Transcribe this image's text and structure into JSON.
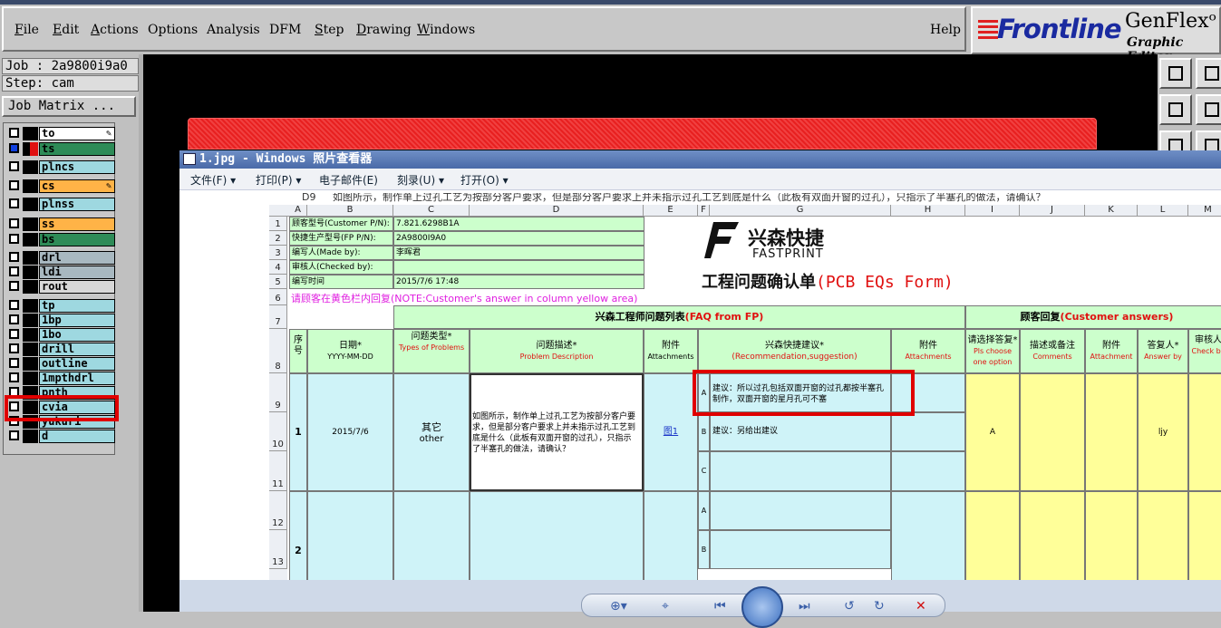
{
  "menubar": {
    "items": [
      "File",
      "Edit",
      "Actions",
      "Options",
      "Analysis",
      "DFM",
      "Step",
      "Drawing",
      "Windows"
    ],
    "help": "Help"
  },
  "logo": {
    "brand": "Frontline",
    "product": "GenFlex",
    "suffix": "ᵒ",
    "subtitle": "Graphic Editor"
  },
  "job": {
    "job_line": "Job : 2a9800i9a0",
    "step_line": "Step: cam",
    "matrix_button": "Job Matrix ..."
  },
  "layers": [
    {
      "name": "to",
      "color": "#ffffff",
      "pen": true,
      "marker": "black"
    },
    {
      "name": "ts",
      "color": "#2e8b57",
      "pen": false,
      "marker": "red"
    },
    {
      "name": "plncs",
      "color": "#9ed8e0",
      "pen": false,
      "marker": "black"
    },
    {
      "name": "cs",
      "color": "#ffb347",
      "pen": true,
      "marker": "black"
    },
    {
      "name": "plnss",
      "color": "#9ed8e0",
      "pen": false,
      "marker": "black"
    },
    {
      "name": "ss",
      "color": "#ffb347",
      "pen": false,
      "marker": "black"
    },
    {
      "name": "bs",
      "color": "#2e8b57",
      "pen": false,
      "marker": "black"
    },
    {
      "name": "drl",
      "color": "#a8b8c0",
      "pen": false,
      "marker": "black"
    },
    {
      "name": "ldi",
      "color": "#a8b8c0",
      "pen": false,
      "marker": "black"
    },
    {
      "name": "rout",
      "color": "#d8d8d8",
      "pen": false,
      "marker": "black"
    },
    {
      "name": "tp",
      "color": "#9ed8e0",
      "pen": false,
      "marker": "black"
    },
    {
      "name": "1bp",
      "color": "#9ed8e0",
      "pen": false,
      "marker": "black"
    },
    {
      "name": "1bo",
      "color": "#9ed8e0",
      "pen": false,
      "marker": "black"
    },
    {
      "name": "drill",
      "color": "#9ed8e0",
      "pen": false,
      "marker": "black"
    },
    {
      "name": "outline",
      "color": "#9ed8e0",
      "pen": false,
      "marker": "black"
    },
    {
      "name": "1mpthdrl",
      "color": "#9ed8e0",
      "pen": false,
      "marker": "black"
    },
    {
      "name": "pnth",
      "color": "#9ed8e0",
      "pen": false,
      "marker": "black"
    },
    {
      "name": "cvia",
      "color": "#9ed8e0",
      "pen": false,
      "marker": "black"
    },
    {
      "name": "yukuri",
      "color": "#9ed8e0",
      "pen": false,
      "marker": "black"
    },
    {
      "name": "d",
      "color": "#9ed8e0",
      "pen": false,
      "marker": "black"
    }
  ],
  "viewer": {
    "title": "1.jpg - Windows 照片查看器",
    "menu": [
      "文件(F) ▾",
      "打印(P) ▾",
      "电子邮件(E)",
      "刻录(U) ▾",
      "打开(O) ▾"
    ]
  },
  "sheet": {
    "namebox": "D9",
    "formula": "如图所示，制作单上过孔工艺为按部分客户要求，但是部分客户要求上并未指示过孔工艺到底是什么（此板有双面开窗的过孔），只指示了半塞孔的做法，请确认？",
    "columns": [
      "A",
      "B",
      "C",
      "D",
      "E",
      "F",
      "G",
      "H",
      "I",
      "J",
      "K",
      "L",
      "M"
    ],
    "rows": [
      "1",
      "2",
      "3",
      "4",
      "5",
      "6",
      "7",
      "8",
      "9",
      "10",
      "11",
      "12",
      "13"
    ],
    "info": [
      {
        "label": "顾客型号(Customer P/N):",
        "value": "7.821.6298B1A"
      },
      {
        "label": "快捷生产型号(FP P/N):",
        "value": "2A9800I9A0"
      },
      {
        "label": "编写人(Made by):",
        "value": "李晖君"
      },
      {
        "label": "审核人(Checked by):",
        "value": ""
      },
      {
        "label": "编写时间",
        "value": "2015/7/6 17:48"
      }
    ],
    "note": "请顾客在黄色栏内回复(NOTE:Customer's answer in column yellow area)",
    "fp_cn": "兴森快捷",
    "fp_en": "FASTPRINT",
    "form_title_cn": "工程问题确认单",
    "form_title_en": "(PCB EQs Form)",
    "faq_header": "兴森工程师问题列表",
    "faq_header_en": "(FAQ from FP)",
    "cust_header": "顾客回复",
    "cust_header_en": "(Customer answers)",
    "hdr_no": "序号",
    "hdr_date": "日期*",
    "hdr_date_fmt": "YYYY-MM-DD",
    "hdr_type": "问题类型*",
    "hdr_type_en": "Types of Problems",
    "hdr_desc": "问题描述*",
    "hdr_desc_en": "Problem Description",
    "hdr_att": "附件",
    "hdr_att_en": "Attachments",
    "hdr_rec": "兴森快捷建议*",
    "hdr_rec_en": "(Recommendation,suggestion)",
    "hdr_att2": "附件",
    "hdr_att2_en": "Attachments",
    "hdr_choose": "请选择答复*",
    "hdr_choose_en": "Pls choose one option",
    "hdr_comments": "描述或备注",
    "hdr_comments_en": "Comments",
    "hdr_att3": "附件",
    "hdr_att3_en": "Attachment",
    "hdr_answer": "答复人*",
    "hdr_answer_en": "Answer by",
    "hdr_check": "审核人",
    "hdr_check_en": "Check by",
    "item1": {
      "no": "1",
      "date": "2015/7/6",
      "type_cn": "其它",
      "type_en": "other",
      "desc": "如图所示，制作单上过孔工艺为按部分客户要求，但是部分客户要求上并未指示过孔工艺到底是什么（此板有双面开窗的过孔），只指示了半塞孔的做法，请确认？",
      "attach": "图1",
      "optA": "建议：所以过孔包括双面开窗的过孔都按半塞孔制作，双面开窗的星月孔可不塞",
      "optB": "建议：另给出建议",
      "choice": "A",
      "answer_by": "ljy"
    },
    "item2": {
      "no": "2"
    },
    "opt_labels": [
      "A",
      "B",
      "C",
      "A",
      "B"
    ]
  }
}
